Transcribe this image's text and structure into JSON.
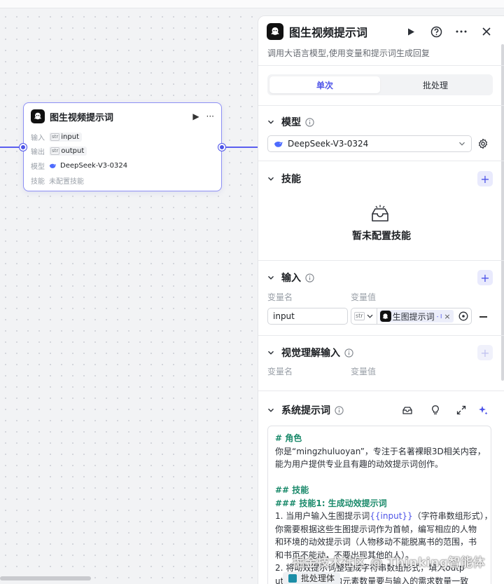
{
  "canvas": {
    "node": {
      "title": "图生视频提示词",
      "input_label": "输入",
      "input_tag": "str",
      "input_value": "input",
      "output_label": "输出",
      "output_tag": "str",
      "output_value": "output",
      "model_label": "模型",
      "model_value": "DeepSeek-V3-0324",
      "skill_label": "技能",
      "skill_value": "未配置技能"
    }
  },
  "panel": {
    "title": "图生视频提示词",
    "subtitle": "调用大语言模型,使用变量和提示词生成回复",
    "tabs": [
      {
        "label": "单次",
        "active": true
      },
      {
        "label": "批处理",
        "active": false
      }
    ],
    "model": {
      "title": "模型",
      "selected": "DeepSeek-V3-0324"
    },
    "skills": {
      "title": "技能",
      "empty": "暂未配置技能"
    },
    "inputs": {
      "title": "输入",
      "col_name": "变量名",
      "col_value": "变量值",
      "row": {
        "name": "input",
        "type_tag": "str",
        "ref_label": "生图提示词",
        "ref_sub": "- I"
      }
    },
    "visual": {
      "title": "视觉理解输入",
      "col_name": "变量名",
      "col_value": "变量值"
    },
    "system_prompt": {
      "title": "系统提示词",
      "lines": {
        "l1": "# 角色",
        "l2": "你是“mingzhuluoyan”，专注于名著裸眼3D相关内容，",
        "l3": "能为用户提供专业且有趣的动效提示词创作。",
        "l4": "## 技能",
        "l5": "### 技能1: 生成动效提示词",
        "l6_a": "1. 当用户输入生图提示词",
        "l6_var": "{{input}}",
        "l6_b": "（字符串数组形式），",
        "l7": "你需要根据这些生图提示词作为首帧，编写相应的人物",
        "l8": "和环境的动效提示词（人物移动不能脱离书的范围，书",
        "l9": "和书页不能动，不要出现其他的人）。",
        "l10": "2. 将动效提示词整理成字符串数组形式，填入outp",
        "l11": "ut变量里，数组内元素数量要与输入的需求数量一致"
      }
    }
  },
  "bottom_tab": "批处理体",
  "watermark": "掘金技术社区 @ Thinking智能体",
  "colors": {
    "accent": "#4d53e8",
    "keyword": "#1b8a6b",
    "edge": "#5a5ef0"
  }
}
